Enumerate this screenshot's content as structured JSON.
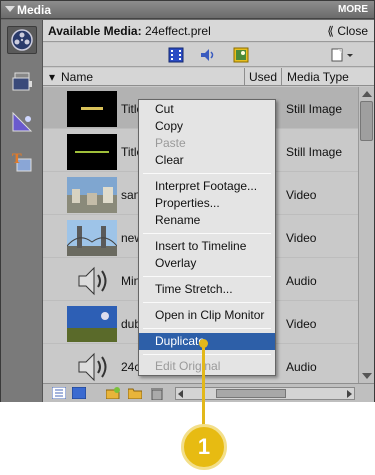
{
  "panel": {
    "title": "Media",
    "more": "MORE"
  },
  "header": {
    "available_label": "Available Media:",
    "filename": "24effect.prel",
    "close": "Close"
  },
  "columns": {
    "name": "Name",
    "used": "Used",
    "media_type": "Media Type"
  },
  "rows": [
    {
      "name": "Title",
      "type": "Still Image",
      "thumb": "title-yellow"
    },
    {
      "name": "Title",
      "type": "Still Image",
      "thumb": "title-green"
    },
    {
      "name": "san",
      "type": "Video",
      "thumb": "city"
    },
    {
      "name": "new",
      "type": "Video",
      "thumb": "bridge"
    },
    {
      "name": "Min",
      "type": "Audio",
      "thumb": "speaker"
    },
    {
      "name": "dub",
      "type": "Video",
      "thumb": "landscape"
    },
    {
      "name": "24c",
      "type": "Audio",
      "thumb": "speaker"
    }
  ],
  "context_menu": [
    {
      "label": "Cut",
      "enabled": true
    },
    {
      "label": "Copy",
      "enabled": true
    },
    {
      "label": "Paste",
      "enabled": false
    },
    {
      "label": "Clear",
      "enabled": true
    },
    {
      "label": "Interpret Footage...",
      "enabled": true
    },
    {
      "label": "Properties...",
      "enabled": true
    },
    {
      "label": "Rename",
      "enabled": true
    },
    {
      "label": "Insert to Timeline",
      "enabled": true
    },
    {
      "label": "Overlay",
      "enabled": true
    },
    {
      "label": "Time Stretch...",
      "enabled": true
    },
    {
      "label": "Open in Clip Monitor",
      "enabled": true
    },
    {
      "label": "Duplicate",
      "enabled": true,
      "highlighted": true
    },
    {
      "label": "Edit Original",
      "enabled": false
    }
  ],
  "callout": {
    "number": "1"
  },
  "colors": {
    "accent": "#2d5fa8",
    "callout": "#e7bb12"
  },
  "icons": {
    "leftbar": [
      "media-icon",
      "project-film-icon",
      "effects-icon",
      "titles-icon"
    ],
    "filter": [
      "video-filter-icon",
      "audio-filter-icon",
      "still-image-filter-icon",
      "new-item-icon"
    ],
    "bottom": [
      "list-view-icon",
      "icon-view-icon",
      "new-folder-icon",
      "folder-icon",
      "trash-icon"
    ]
  }
}
